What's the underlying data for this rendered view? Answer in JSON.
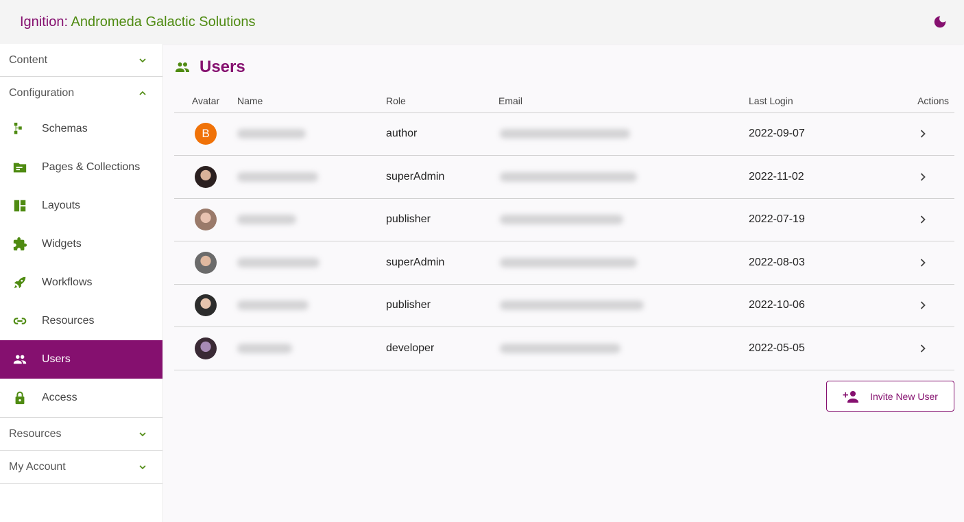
{
  "header": {
    "brand_prefix": "Ignition:",
    "brand_name": "Andromeda Galactic Solutions",
    "theme_toggle_icon": "moon-icon"
  },
  "colors": {
    "primary": "#85106f",
    "accent": "#4f8b12",
    "avatar_initial_bg": "#f07208"
  },
  "sidebar": {
    "sections": [
      {
        "label": "Content",
        "expanded": false
      },
      {
        "label": "Configuration",
        "expanded": true
      },
      {
        "label": "Resources",
        "expanded": false
      },
      {
        "label": "My Account",
        "expanded": false
      }
    ],
    "configuration_items": [
      {
        "label": "Schemas",
        "icon": "schema-icon",
        "active": false
      },
      {
        "label": "Pages & Collections",
        "icon": "folder-icon",
        "active": false
      },
      {
        "label": "Layouts",
        "icon": "layout-icon",
        "active": false
      },
      {
        "label": "Widgets",
        "icon": "puzzle-icon",
        "active": false
      },
      {
        "label": "Workflows",
        "icon": "rocket-icon",
        "active": false
      },
      {
        "label": "Resources",
        "icon": "link-icon",
        "active": false
      },
      {
        "label": "Users",
        "icon": "users-icon",
        "active": true
      },
      {
        "label": "Access",
        "icon": "lock-icon",
        "active": false
      }
    ]
  },
  "main": {
    "title": "Users",
    "title_icon": "users-icon",
    "table": {
      "columns": [
        "Avatar",
        "Name",
        "Role",
        "Email",
        "Last Login",
        "Actions"
      ],
      "rows": [
        {
          "avatar": "B",
          "avatar_type": "initial",
          "name": "[redacted]",
          "role": "author",
          "email": "[redacted]",
          "last_login": "2022-09-07"
        },
        {
          "avatar": "photo",
          "avatar_type": "photo",
          "name": "[redacted]",
          "role": "superAdmin",
          "email": "[redacted]",
          "last_login": "2022-11-02"
        },
        {
          "avatar": "photo",
          "avatar_type": "photo",
          "name": "[redacted]",
          "role": "publisher",
          "email": "[redacted]",
          "last_login": "2022-07-19"
        },
        {
          "avatar": "photo",
          "avatar_type": "photo",
          "name": "[redacted]",
          "role": "superAdmin",
          "email": "[redacted]",
          "last_login": "2022-08-03"
        },
        {
          "avatar": "photo",
          "avatar_type": "photo",
          "name": "[redacted]",
          "role": "publisher",
          "email": "[redacted]",
          "last_login": "2022-10-06"
        },
        {
          "avatar": "photo",
          "avatar_type": "photo",
          "name": "[redacted]",
          "role": "developer",
          "email": "[redacted]",
          "last_login": "2022-05-05"
        }
      ]
    },
    "invite_button": {
      "label": "Invite New User",
      "icon": "person-add-icon"
    }
  }
}
